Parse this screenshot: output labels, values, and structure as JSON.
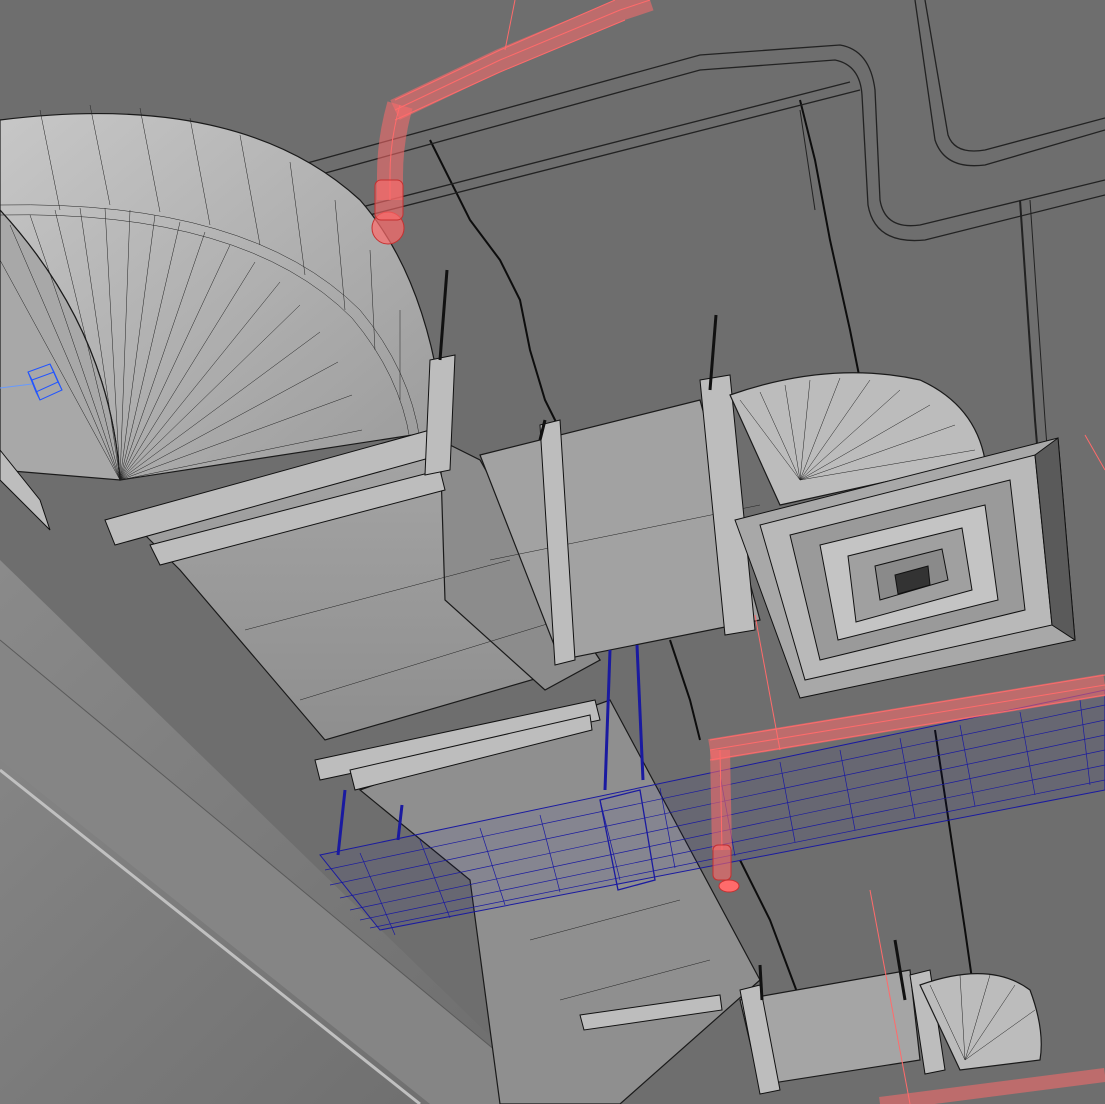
{
  "scene": {
    "colors": {
      "background": "#6b6b6b",
      "ceiling": "#707070",
      "beam": "#8c8c8c",
      "duct": "#9a9a9a",
      "duct_light": "#b5b5b5",
      "sprinkler_pipe": "#ff6b6b",
      "cable_tray": "#1a1aa0",
      "gizmo": "#2255ff"
    },
    "elements": [
      "hvac-duct-elbow",
      "hvac-duct-straight",
      "ceiling-diffuser",
      "sprinkler-pipe",
      "sprinkler-head",
      "cable-tray",
      "conduit-pipe",
      "hanger-rod",
      "transform-gizmo"
    ]
  }
}
